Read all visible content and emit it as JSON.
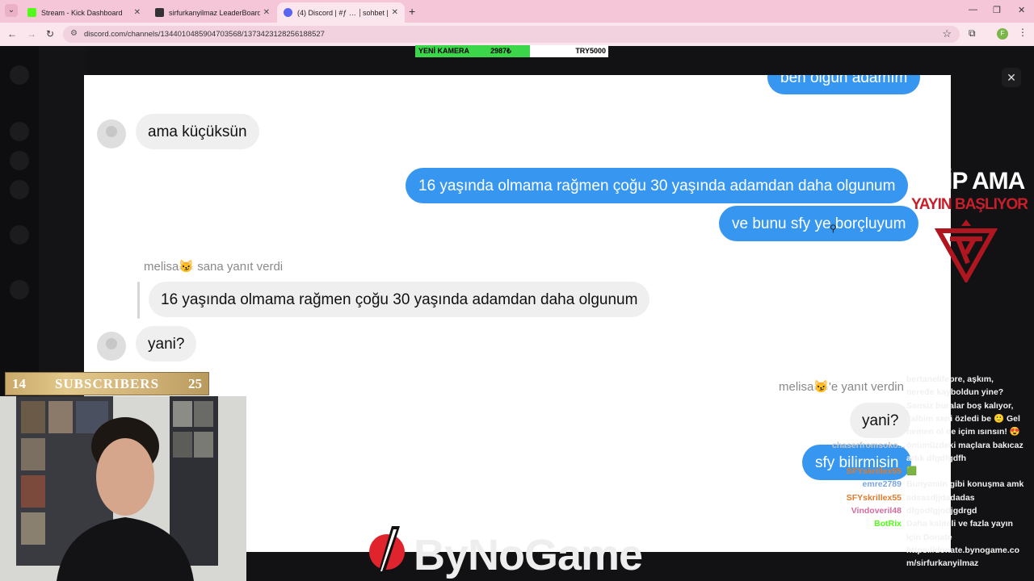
{
  "browser": {
    "tabs": [
      {
        "title": "Stream - Kick Dashboard",
        "favicon_color": "#53fc18"
      },
      {
        "title": "sirfurkanyilmaz LeaderBoard | T",
        "favicon_color": "#333333"
      },
      {
        "title": "(4) Discord | #ƒ … │sohbet | No",
        "favicon_color": "#5865f2"
      }
    ],
    "url": "discord.com/channels/1344010485904703568/1373423128256188527",
    "profile_initial": "F",
    "tab_color": "#f4c6d8"
  },
  "overlay_banner": {
    "camera_label": "YENİ KAMERA",
    "amount": "2987₺",
    "goal": "TRY5000"
  },
  "dm_screenshot": {
    "messages": [
      {
        "side": "out",
        "text": "ben olgun adamım"
      },
      {
        "side": "in",
        "text": "ama küçüksün"
      },
      {
        "side": "out",
        "text": "16 yaşında olmama rağmen çoğu 30 yaşında adamdan daha olgunum"
      },
      {
        "side": "out",
        "text": "ve bunu sfy ye borçluyum"
      },
      {
        "side": "in",
        "text": "16 yaşında olmama rağmen çoğu 30 yaşında adamdan daha olgunum"
      },
      {
        "side": "in",
        "text": "yani?"
      },
      {
        "side": "out",
        "text": "yani?"
      },
      {
        "side": "out",
        "text": "sfy bilirmisin"
      }
    ],
    "reply_incoming": {
      "name": "melisa",
      "emoji": "😼",
      "text": "sana yanıt verdi"
    },
    "reply_outgoing": {
      "name": "melisa",
      "emoji": "😼",
      "text": "'e yanıt verdin"
    },
    "incoming_bubble_color": "#efefef",
    "outgoing_bubble_color": "#3797f0"
  },
  "stream_overlay": {
    "klip_text": "KLİP AMA",
    "yayin_text": "YAYIN BAŞLIYOR",
    "subscribers": {
      "left": "14",
      "label": "SUBSCRIBERS",
      "right": "25"
    },
    "logo_text": "ByNoGame"
  },
  "chat": [
    {
      "user": "",
      "message": "bertanelifepre, aşkım,",
      "color": "#e9e9e9"
    },
    {
      "user": "",
      "message": "neređe kayboldun yine?",
      "color": "#e9e9e9"
    },
    {
      "user": "",
      "message": "Sensiz buralar boş kalıyor,",
      "color": "#e9e9e9"
    },
    {
      "user": "",
      "message": "kalbim seni özledi be 🙂 Gel",
      "color": "#e9e9e9"
    },
    {
      "user": "",
      "message": "hemen ol de içim ısınsın! 😍",
      "color": "#e9e9e9"
    },
    {
      "user": "chaserfromsoko...",
      "message": "önümüzdeki maçlara bakıcaz",
      "color": "#c6c6c6"
    },
    {
      "user": "",
      "message": "artık dfgdfgdfh",
      "color": "#e9e9e9"
    },
    {
      "user": "SFYskrillex55",
      "message": "🟩",
      "color": "#e07a2a"
    },
    {
      "user": "emre2789",
      "message": "Bunyamin gibi konuşma amk",
      "color": "#7aa4e0"
    },
    {
      "user": "SFYskrillex55",
      "message": "adsasdjjdadadas",
      "color": "#e07a2a"
    },
    {
      "user": "Vindoveril48",
      "message": "dfgodfgjodjgdrgd",
      "color": "#d46b9e"
    },
    {
      "user": "BotRix",
      "message": "Daha kaliteli ve fazla yayın",
      "color": "#53fc18"
    },
    {
      "user": "",
      "message": "için Donate",
      "color": "#e9e9e9"
    },
    {
      "user": "",
      "message": "https://donate.bynogame.co",
      "color": "#ffffff"
    },
    {
      "user": "",
      "message": "m/sirfurkanyilmaz",
      "color": "#ffffff"
    }
  ]
}
